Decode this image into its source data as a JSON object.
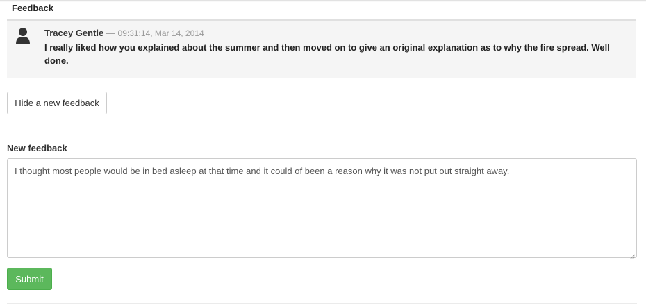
{
  "section": {
    "title": "Feedback"
  },
  "comment": {
    "author": "Tracey Gentle",
    "separator": "—",
    "timestamp": "09:31:14, Mar 14, 2014",
    "body": "I really liked how you explained about the summer and then moved on to give an original explanation as to why the fire spread. Well done.",
    "avatar_icon": "user-icon"
  },
  "toggle_button": {
    "label": "Hide a new feedback"
  },
  "new_feedback": {
    "label": "New feedback",
    "value": "I thought most people would be in bed asleep at that time and it could of been a reason why it was not put out straight away."
  },
  "submit_button": {
    "label": "Submit",
    "color": "#5cb85c"
  },
  "colors": {
    "comment_background": "#f5f5f5",
    "muted_text": "#999999"
  }
}
